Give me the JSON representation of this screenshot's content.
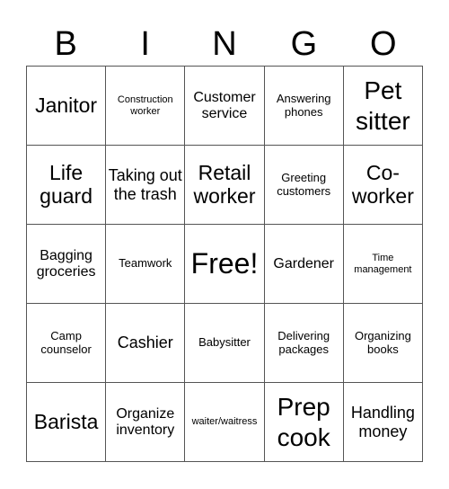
{
  "header": {
    "letters": [
      "B",
      "I",
      "N",
      "G",
      "O"
    ]
  },
  "cells": [
    "Janitor",
    "Construction worker",
    "Customer service",
    "Answering phones",
    "Pet sitter",
    "Life guard",
    "Taking out the trash",
    "Retail worker",
    "Greeting customers",
    "Co-worker",
    "Bagging groceries",
    "Teamwork",
    "Free!",
    "Gardener",
    "Time management",
    "Camp counselor",
    "Cashier",
    "Babysitter",
    "Delivering packages",
    "Organizing books",
    "Barista",
    "Organize inventory",
    "waiter/waitress",
    "Prep cook",
    "Handling money"
  ]
}
